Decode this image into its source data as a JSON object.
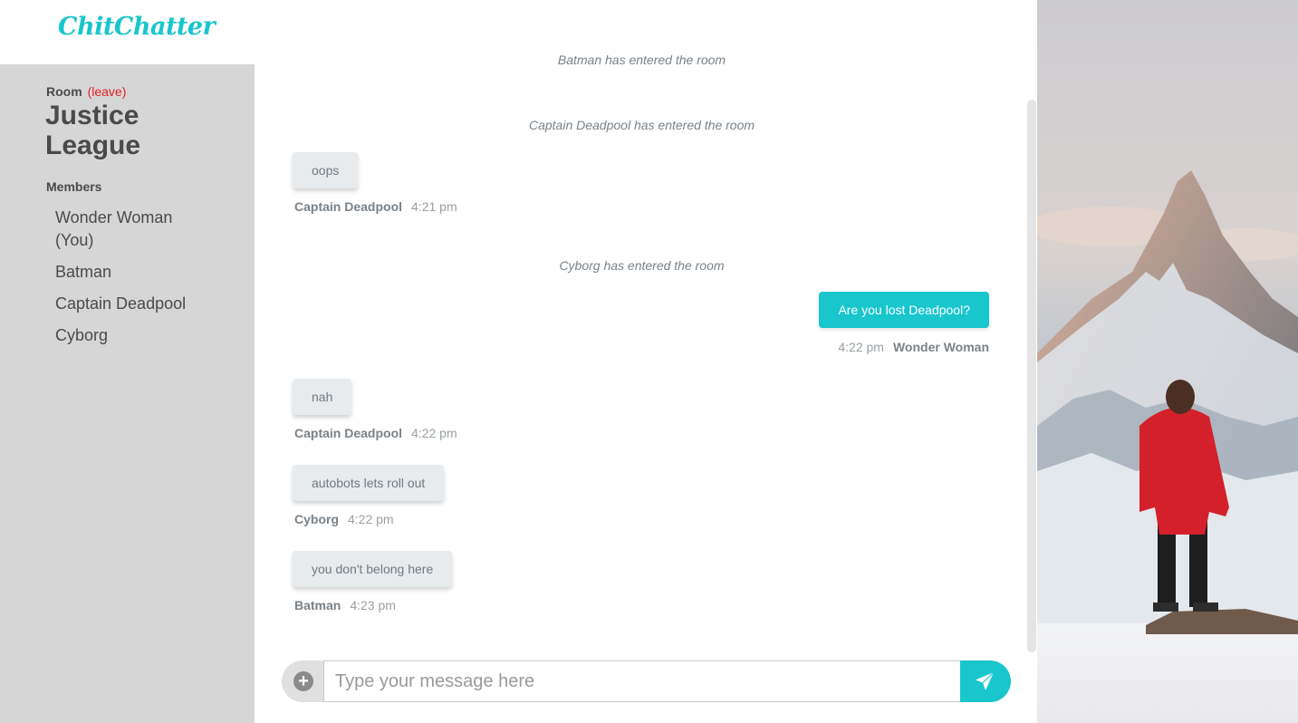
{
  "app": {
    "logo_text": "ChitChatter",
    "brand_color": "#18c6cc"
  },
  "sidebar": {
    "room_label": "Room",
    "leave_label": "(leave)",
    "leave_color": "#e02020",
    "room_name": "Justice League",
    "members_heading": "Members",
    "members": [
      "Wonder Woman (You)",
      "Batman",
      "Captain Deadpool",
      "Cyborg"
    ]
  },
  "chat": {
    "cut_off_system": "Batman has entered the room",
    "messages": [
      {
        "kind": "system",
        "text": "Captain Deadpool has entered the room"
      },
      {
        "kind": "incoming",
        "text": "oops",
        "author": "Captain Deadpool",
        "time": "4:21 pm"
      },
      {
        "kind": "system",
        "text": "Cyborg has entered the room"
      },
      {
        "kind": "outgoing",
        "text": "Are you lost Deadpool?",
        "author": "Wonder Woman",
        "time": "4:22 pm"
      },
      {
        "kind": "incoming",
        "text": "nah",
        "author": "Captain Deadpool",
        "time": "4:22 pm"
      },
      {
        "kind": "incoming",
        "text": "autobots lets roll out",
        "author": "Cyborg",
        "time": "4:22 pm"
      },
      {
        "kind": "incoming",
        "text": "you don't belong here",
        "author": "Batman",
        "time": "4:23 pm"
      }
    ]
  },
  "composer": {
    "placeholder": "Type your message here",
    "attach_icon": "plus-circle-icon",
    "send_icon": "paper-plane-icon"
  }
}
